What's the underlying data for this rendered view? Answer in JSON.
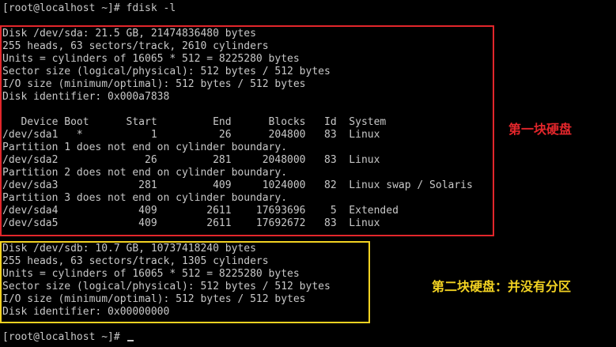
{
  "terminal": {
    "prompt_command": "[root@localhost ~]# fdisk -l",
    "disk1": {
      "header": "Disk /dev/sda: 21.5 GB, 21474836480 bytes",
      "geometry": "255 heads, 63 sectors/track, 2610 cylinders",
      "units": "Units = cylinders of 16065 * 512 = 8225280 bytes",
      "sector_size": "Sector size (logical/physical): 512 bytes / 512 bytes",
      "io_size": "I/O size (minimum/optimal): 512 bytes / 512 bytes",
      "identifier": "Disk identifier: 0x000a7838",
      "table_header": "   Device Boot      Start         End      Blocks   Id  System",
      "rows": [
        "/dev/sda1   *           1          26      204800   83  Linux",
        "Partition 1 does not end on cylinder boundary.",
        "/dev/sda2              26         281     2048000   83  Linux",
        "Partition 2 does not end on cylinder boundary.",
        "/dev/sda3             281         409     1024000   82  Linux swap / Solaris",
        "Partition 3 does not end on cylinder boundary.",
        "/dev/sda4             409        2611    17693696    5  Extended",
        "/dev/sda5             409        2611    17692672   83  Linux"
      ]
    },
    "disk2": {
      "header": "Disk /dev/sdb: 10.7 GB, 10737418240 bytes",
      "geometry": "255 heads, 63 sectors/track, 1305 cylinders",
      "units": "Units = cylinders of 16065 * 512 = 8225280 bytes",
      "sector_size": "Sector size (logical/physical): 512 bytes / 512 bytes",
      "io_size": "I/O size (minimum/optimal): 512 bytes / 512 bytes",
      "identifier": "Disk identifier: 0x00000000"
    },
    "final_prompt": "[root@localhost ~]# "
  },
  "annotations": {
    "first_disk": "第一块硬盘",
    "second_disk": "第二块硬盘：并没有分区",
    "first_color": "#e2262b",
    "second_color": "#f2d222"
  }
}
